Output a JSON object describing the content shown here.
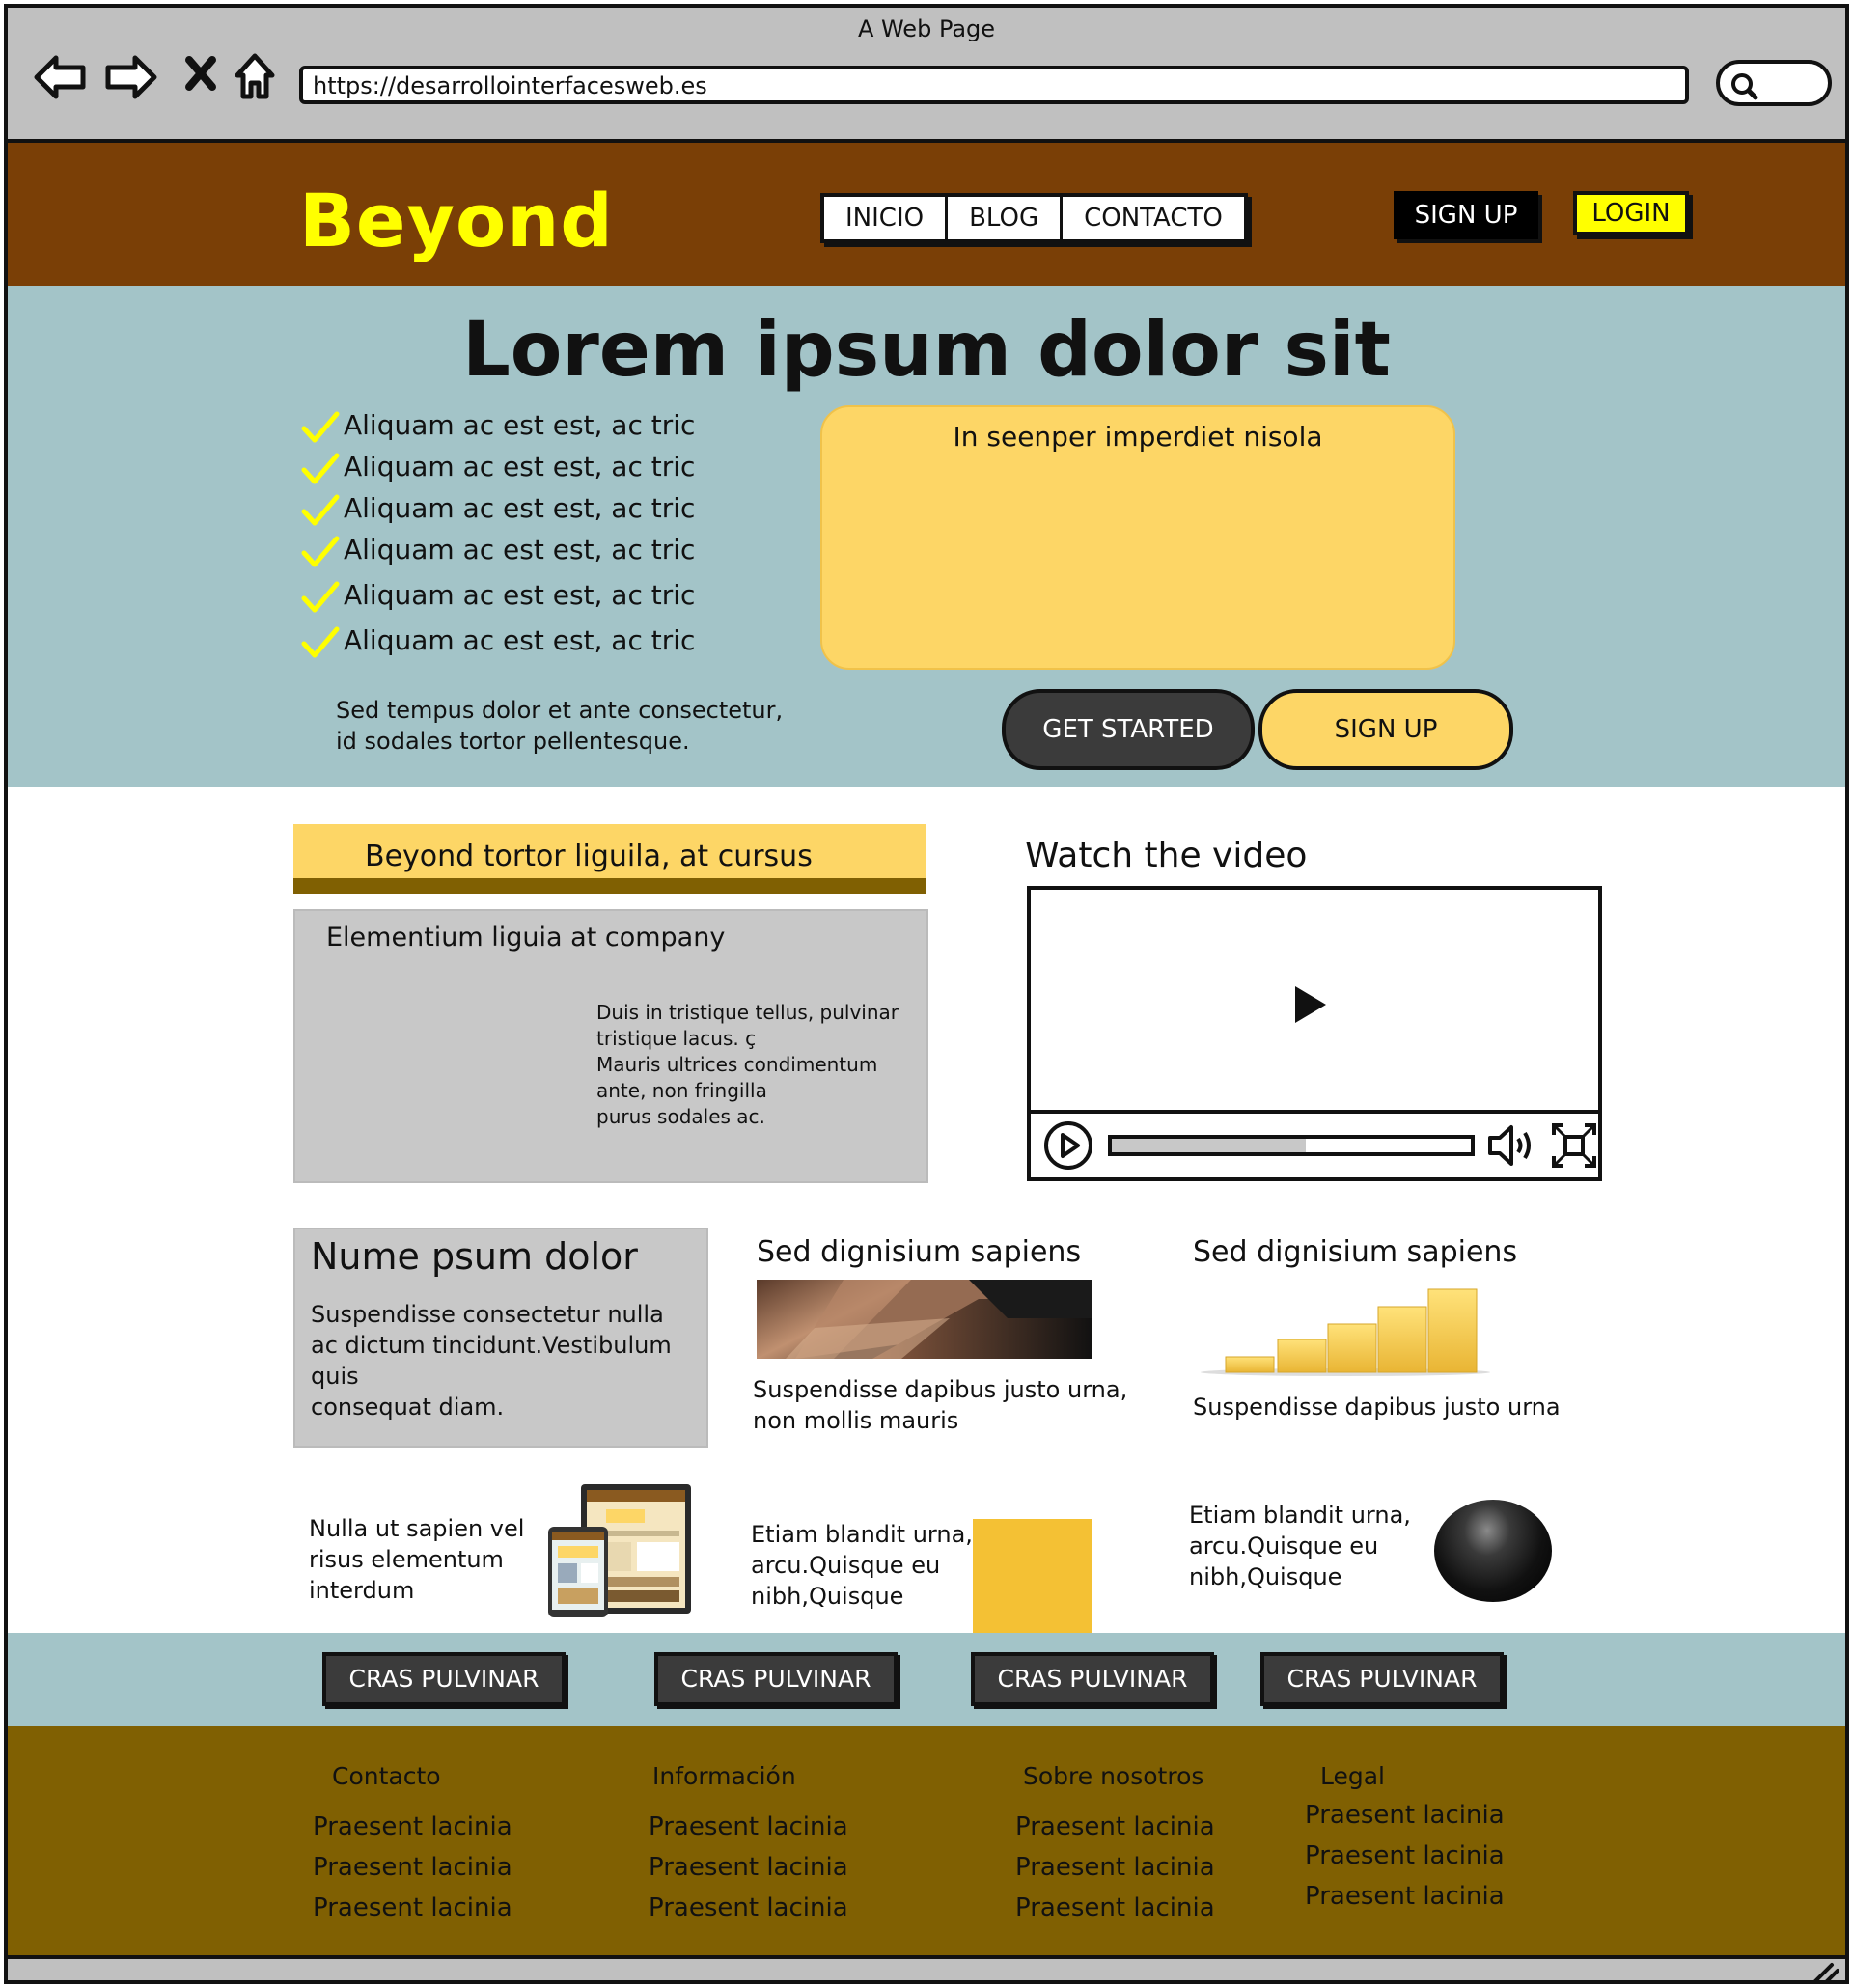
{
  "browser": {
    "title": "A Web Page",
    "url": "https://desarrollointerfacesweb.es"
  },
  "header": {
    "logo": "Beyond",
    "nav": [
      "INICIO",
      "BLOG",
      "CONTACTO"
    ],
    "signup": "SIGN UP",
    "login": "LOGIN"
  },
  "hero": {
    "title": "Lorem ipsum dolor sit",
    "checklist": [
      "Aliquam ac est  est, ac tric",
      "Aliquam ac est  est, ac tric",
      "Aliquam ac est  est, ac tric",
      "Aliquam ac est  est, ac tric",
      "Aliquam ac est  est, ac tric",
      "Aliquam ac est  est, ac tric"
    ],
    "subtitle": "Sed tempus dolor et ante consectetur,\nid sodales tortor pellentesque.",
    "card_title": "In seenper imperdiet nisola",
    "get_started": "GET STARTED",
    "signup": "SIGN UP"
  },
  "feature": {
    "title": "Beyond tortor liguila, at cursus",
    "subtitle": "Elementium liguia at company",
    "text": "Duis in tristique tellus, pulvinar\ntristique lacus. ç\nMauris ultrices condimentum\nante, non fringilla\n purus sodales ac."
  },
  "video": {
    "title": "Watch the video",
    "progress": 0.54
  },
  "nume": {
    "title": "Nume psum dolor",
    "text": "Suspendisse consectetur nulla\nac dictum tincidunt.Vestibulum\nquis\nconsequat diam."
  },
  "col2": {
    "title": "Sed dignisium sapiens",
    "text": "Suspendisse dapibus justo urna,\n non mollis mauris"
  },
  "col3": {
    "title": "Sed dignisium sapiens",
    "text": "Suspendisse dapibus justo urna"
  },
  "row3": {
    "a": "Nulla ut sapien vel\nrisus elementum\ninterdum",
    "b": "Etiam blandit urna,\narcu.Quisque eu\nnibh,Quisque",
    "c": "Etiam blandit urna,\narcu.Quisque eu\nnibh,Quisque"
  },
  "cta": [
    "CRAS PULVINAR",
    "CRAS PULVINAR",
    "CRAS PULVINAR",
    "CRAS PULVINAR"
  ],
  "footer": {
    "columns": [
      {
        "heading": "Contacto",
        "links": [
          "Praesent lacinia",
          "Praesent lacinia",
          "Praesent lacinia"
        ]
      },
      {
        "heading": "Información",
        "links": [
          "Praesent lacinia",
          "Praesent lacinia",
          "Praesent lacinia"
        ]
      },
      {
        "heading": "Sobre nosotros",
        "links": [
          "Praesent lacinia",
          "Praesent lacinia",
          "Praesent lacinia"
        ]
      },
      {
        "heading": "Legal",
        "links": [
          "Praesent lacinia",
          "Praesent lacinia",
          "Praesent lacinia"
        ]
      }
    ]
  },
  "colors": {
    "header_bg": "#7a3f06",
    "logo": "#ffff00",
    "hero_bg": "#a3c4c8",
    "card_yellow": "#fdd666",
    "footer_bg": "#806002",
    "check": "#ffff00"
  },
  "icons": [
    "back-arrow-icon",
    "forward-arrow-icon",
    "close-icon",
    "home-icon",
    "search-icon",
    "check-icon",
    "play-icon",
    "volume-icon",
    "fullscreen-icon",
    "resize-grip-icon"
  ]
}
